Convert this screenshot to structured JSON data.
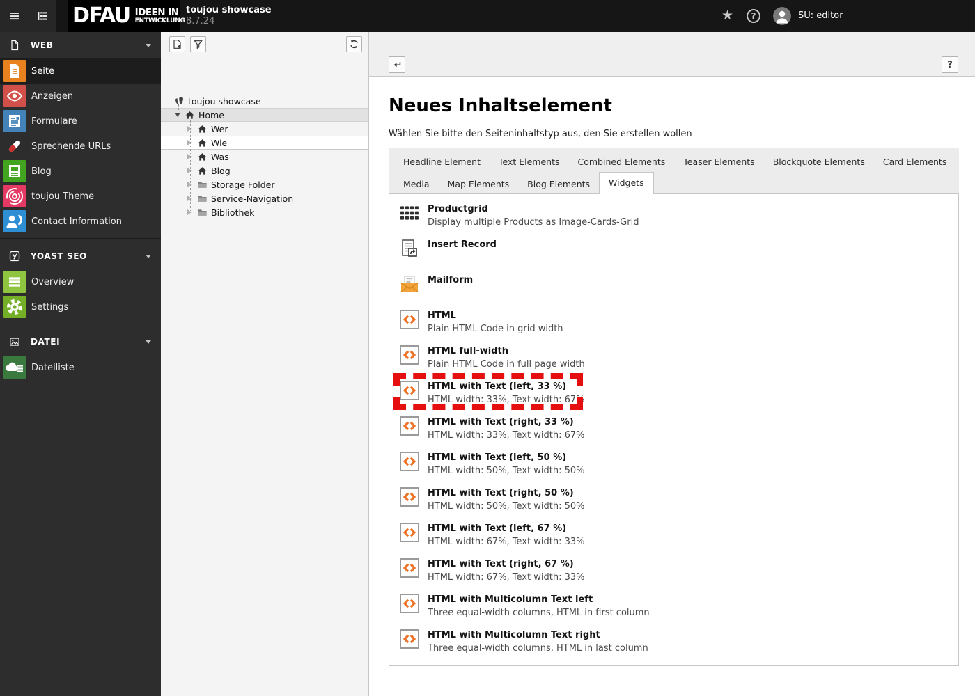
{
  "topbar": {
    "logo_main": "DFAU",
    "logo_tagline_line1": "IDEEN IN",
    "logo_tagline_line2": "ENTWICKLUNG",
    "site_title": "toujou showcase",
    "version": "8.7.24",
    "user_label": "SU: editor"
  },
  "icons": {
    "star": "★",
    "help": "?"
  },
  "sidebar": {
    "sections": [
      {
        "label": "WEB",
        "items": [
          {
            "label": "Seite",
            "color": "#e8821e",
            "active": true
          },
          {
            "label": "Anzeigen",
            "color": "#d2504a"
          },
          {
            "label": "Formulare",
            "color": "#4383b8"
          },
          {
            "label": "Sprechende URLs",
            "color": ""
          },
          {
            "label": "Blog",
            "color": "#43a41f"
          },
          {
            "label": "toujou Theme",
            "color": "#e43963"
          },
          {
            "label": "Contact Information",
            "color": "#2f8fd5"
          }
        ]
      },
      {
        "label": "YOAST SEO",
        "items": [
          {
            "label": "Overview",
            "color": "#8fc440"
          },
          {
            "label": "Settings",
            "color": "#74af27"
          }
        ]
      },
      {
        "label": "DATEI",
        "items": [
          {
            "label": "Dateiliste",
            "color": "#3a7a3e"
          }
        ]
      }
    ]
  },
  "pagetree": {
    "root_label": "toujou showcase",
    "nodes": [
      {
        "label": "Home",
        "expanded": true
      },
      {
        "label": "Wer"
      },
      {
        "label": "Wie",
        "selected": true
      },
      {
        "label": "Was"
      },
      {
        "label": "Blog"
      },
      {
        "label": "Storage Folder"
      },
      {
        "label": "Service-Navigation"
      },
      {
        "label": "Bibliothek"
      }
    ]
  },
  "content": {
    "title": "Neues Inhaltselement",
    "subtitle": "Wählen Sie bitte den Seiteninhaltstyp aus, den Sie erstellen wollen",
    "help_label": "?",
    "tabs_row1": [
      "Headline Element",
      "Text Elements",
      "Combined Elements",
      "Teaser Elements",
      "Blockquote Elements",
      "Card Elements"
    ],
    "tabs_row2": [
      "Media",
      "Map Elements",
      "Blog Elements",
      "Widgets"
    ],
    "active_tab": "Widgets",
    "highlight_color": "#e60f0f",
    "items": [
      {
        "title": "Productgrid",
        "desc": "Display multiple Products as Image-Cards-Grid"
      },
      {
        "title": "Insert Record",
        "desc": ""
      },
      {
        "title": "Mailform",
        "desc": ""
      },
      {
        "title": "HTML",
        "desc": "Plain HTML Code in grid width"
      },
      {
        "title": "HTML full-width",
        "desc": "Plain HTML Code in full page width"
      },
      {
        "title": "HTML with Text (left, 33 %)",
        "desc": "HTML width: 33%, Text width: 67%",
        "highlighted": true
      },
      {
        "title": "HTML with Text (right, 33 %)",
        "desc": "HTML width: 33%, Text width: 67%"
      },
      {
        "title": "HTML with Text (left, 50 %)",
        "desc": "HTML width: 50%, Text width: 50%"
      },
      {
        "title": "HTML with Text (right, 50 %)",
        "desc": "HTML width: 50%, Text width: 50%"
      },
      {
        "title": "HTML with Text (left, 67 %)",
        "desc": "HTML width: 67%, Text width: 33%"
      },
      {
        "title": "HTML with Text (right, 67 %)",
        "desc": "HTML width: 67%, Text width: 33%"
      },
      {
        "title": "HTML with Multicolumn Text left",
        "desc": "Three equal-width columns, HTML in first column"
      },
      {
        "title": "HTML with Multicolumn Text right",
        "desc": "Three equal-width columns, HTML in last column"
      }
    ]
  }
}
